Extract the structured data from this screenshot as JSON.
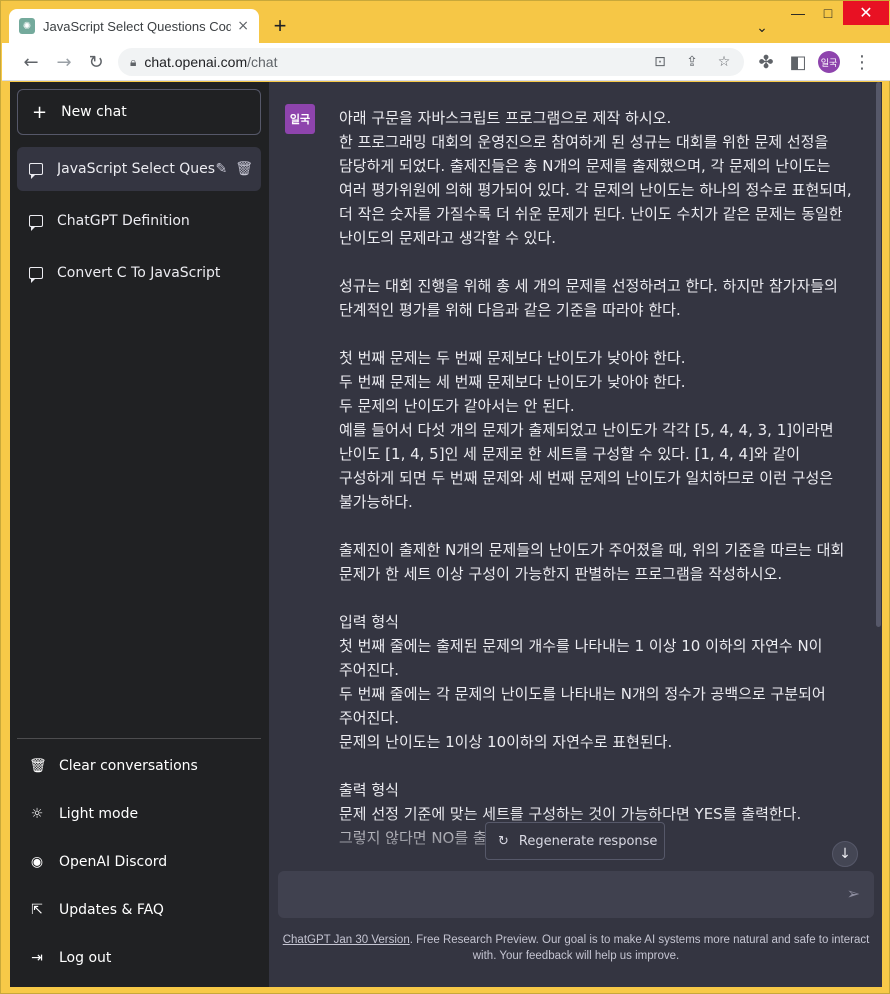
{
  "browser": {
    "tab_title": "JavaScript Select Questions Cod",
    "tab_close": "×",
    "new_tab": "+",
    "tab_search": "⌄",
    "minimize": "—",
    "maximize": "□",
    "close": "✕",
    "url_host": "chat.openai.com",
    "url_path": "/chat",
    "profile": "일국"
  },
  "sidebar": {
    "new_chat": "New chat",
    "conversations": [
      {
        "label": "JavaScript Select Quest"
      },
      {
        "label": "ChatGPT Definition"
      },
      {
        "label": "Convert C To JavaScript"
      }
    ],
    "menu": [
      {
        "label": "Clear conversations",
        "icon": "trash-icon"
      },
      {
        "label": "Light mode",
        "icon": "sun-icon"
      },
      {
        "label": "OpenAI Discord",
        "icon": "discord-icon"
      },
      {
        "label": "Updates & FAQ",
        "icon": "external-link-icon"
      },
      {
        "label": "Log out",
        "icon": "logout-icon"
      }
    ]
  },
  "message": {
    "avatar": "일국",
    "text": "아래 구문을 자바스크립트 프로그램으로 제작 하시오.\n한 프로그래밍 대회의 운영진으로 참여하게 된 성규는 대회를 위한 문제 선정을 담당하게 되었다. 출제진들은 총 N개의 문제를 출제했으며, 각 문제의 난이도는 여러 평가위원에 의해 평가되어 있다. 각 문제의 난이도는 하나의 정수로 표현되며, 더 작은 숫자를 가질수록 더 쉬운 문제가 된다. 난이도 수치가 같은 문제는 동일한 난이도의 문제라고 생각할 수 있다.\n\n성규는 대회 진행을 위해 총 세 개의 문제를 선정하려고 한다. 하지만 참가자들의 단계적인 평가를 위해 다음과 같은 기준을 따라야 한다.\n\n첫 번째 문제는 두 번째 문제보다 난이도가 낮아야 한다.\n두 번째 문제는 세 번째 문제보다 난이도가 낮아야 한다.\n두 문제의 난이도가 같아서는 안 된다.\n예를 들어서 다섯 개의 문제가 출제되었고 난이도가 각각 [5, 4, 4, 3, 1]이라면 난이도 [1, 4, 5]인 세 문제로 한 세트를 구성할 수 있다. [1, 4, 4]와 같이 구성하게 되면 두 번째 문제와 세 번째 문제의 난이도가 일치하므로 이런 구성은 불가능하다.\n\n출제진이 출제한 N개의 문제들의 난이도가 주어졌을 때, 위의 기준을 따르는 대회 문제가 한 세트 이상 구성이 가능한지 판별하는 프로그램을 작성하시오.\n\n입력 형식\n첫 번째 줄에는 출제된 문제의 개수를 나타내는 1 이상 10 이하의 자연수 N이 주어진다.\n두 번째 줄에는 각 문제의 난이도를 나타내는 N개의 정수가 공백으로 구분되어 주어진다.\n문제의 난이도는 1이상 10이하의 자연수로 표현된다.\n\n출력 형식\n문제 선정 기준에 맞는 세트를 구성하는 것이 가능하다면 YES를 출력한다.\n그렇지 않다면 NO를 출력한다."
  },
  "controls": {
    "regenerate": "Regenerate response",
    "input_placeholder": ""
  },
  "footer": {
    "link": "ChatGPT Jan 30 Version",
    "text": ". Free Research Preview. Our goal is to make AI systems more natural and safe to interact with. Your feedback will help us improve."
  },
  "colors": {
    "sidebar_bg": "#202123",
    "main_bg": "#343541",
    "input_bg": "#40414f",
    "avatar_bg": "#8e44ad",
    "window_frame": "#f6c746"
  }
}
